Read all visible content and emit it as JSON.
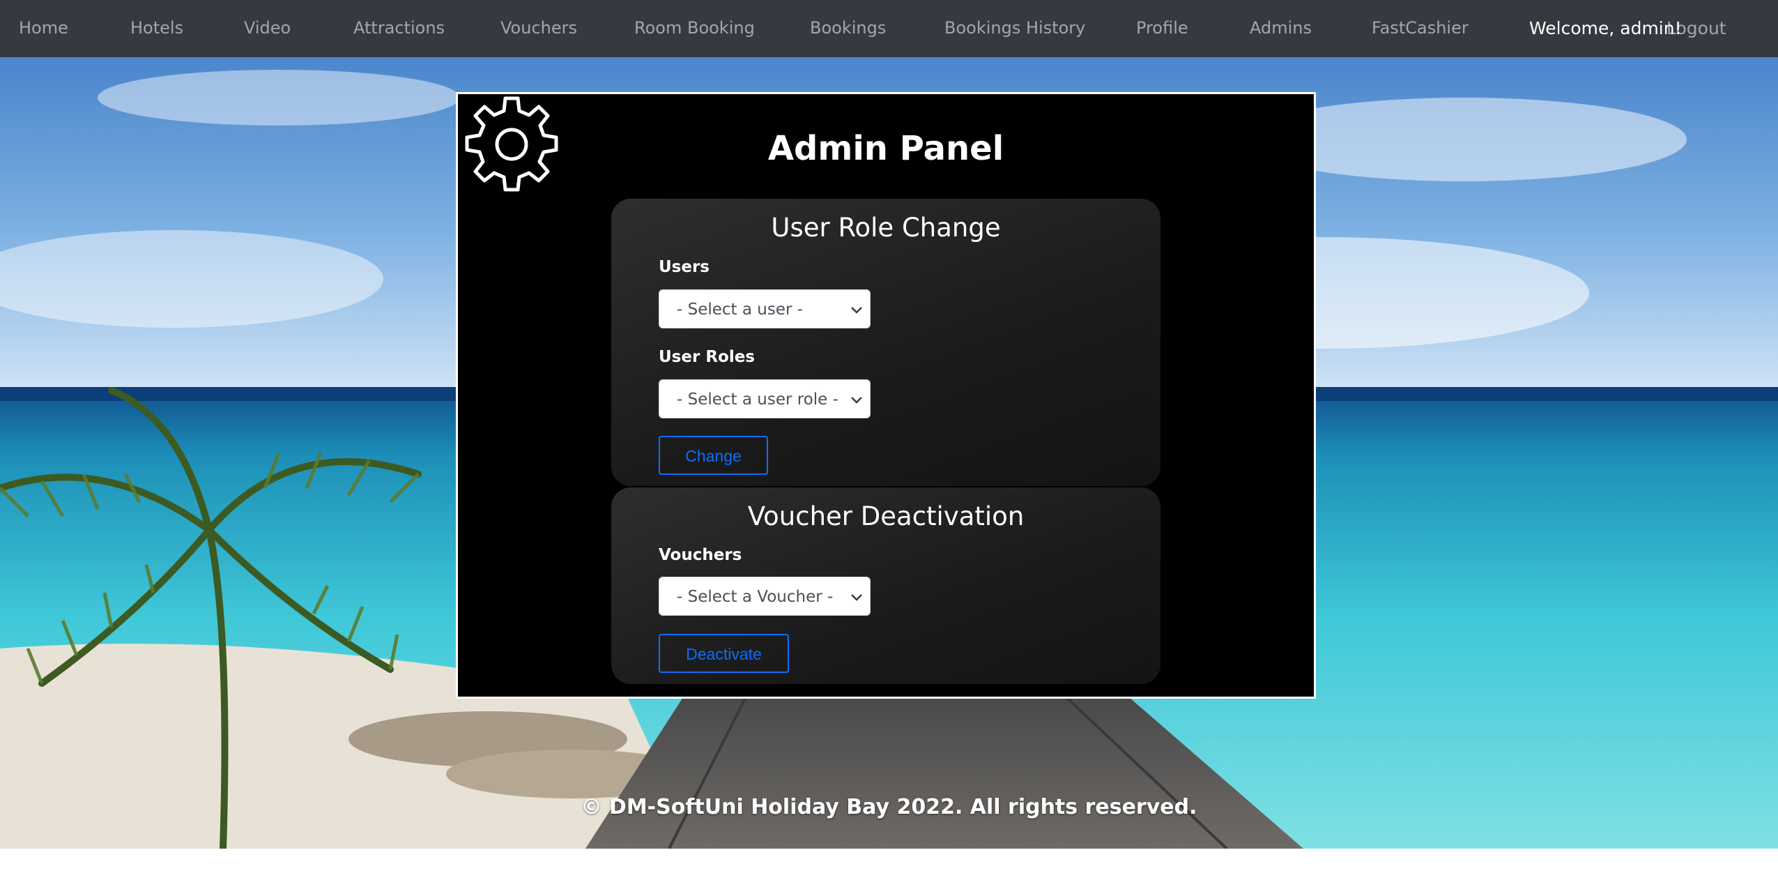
{
  "nav": {
    "items": [
      {
        "label": "Home"
      },
      {
        "label": "Hotels"
      },
      {
        "label": "Video"
      },
      {
        "label": "Attractions"
      },
      {
        "label": "Vouchers"
      },
      {
        "label": "Room Booking"
      },
      {
        "label": "Bookings"
      },
      {
        "label": "Bookings History"
      },
      {
        "label": "Profile"
      },
      {
        "label": "Admins"
      },
      {
        "label": "FastCashier"
      }
    ],
    "welcome": "Welcome, admin!",
    "logout": "Logout"
  },
  "panel": {
    "title": "Admin Panel",
    "icon": "gear-icon",
    "role_change": {
      "title": "User Role Change",
      "users_label": "Users",
      "users_selected": "- Select a user -",
      "roles_label": "User Roles",
      "roles_selected": "- Select a user role -",
      "button": "Change"
    },
    "voucher": {
      "title": "Voucher Deactivation",
      "vouchers_label": "Vouchers",
      "vouchers_selected": "- Select a Voucher -",
      "button": "Deactivate"
    }
  },
  "footer": "© DM-SoftUni Holiday Bay 2022. All rights reserved.",
  "colors": {
    "navbar": "#343a40",
    "panel": "#000000",
    "accent": "#0d6efd"
  }
}
